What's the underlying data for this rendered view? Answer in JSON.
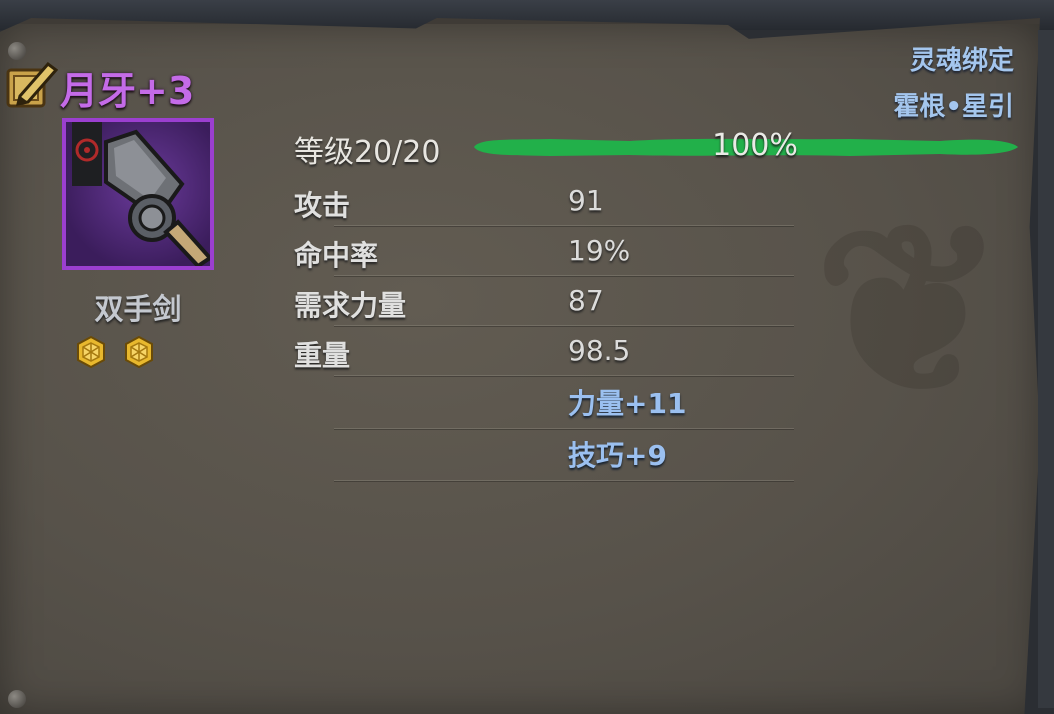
{
  "item": {
    "name": "月牙+3",
    "type": "双手剑",
    "gem_count": 2,
    "name_color": "#c46be8",
    "rarity_border_color": "#9b3fd0"
  },
  "tags": {
    "soul_bind": "灵魂绑定",
    "source": "霍根•星引"
  },
  "level": {
    "label": "等级20/20",
    "percent_text": "100%",
    "progress": 1.0,
    "bar_color": "#22b04a"
  },
  "stats": [
    {
      "label": "攻击",
      "value": "91"
    },
    {
      "label": "命中率",
      "value": "19%"
    },
    {
      "label": "需求力量",
      "value": "87"
    },
    {
      "label": "重量",
      "value": "98.5"
    }
  ],
  "bonuses": [
    "力量+11",
    "技巧+9"
  ],
  "icons": {
    "edit": "edit-pencil-icon",
    "gem": "gold-gem-icon",
    "item": "two-handed-sword-icon"
  }
}
